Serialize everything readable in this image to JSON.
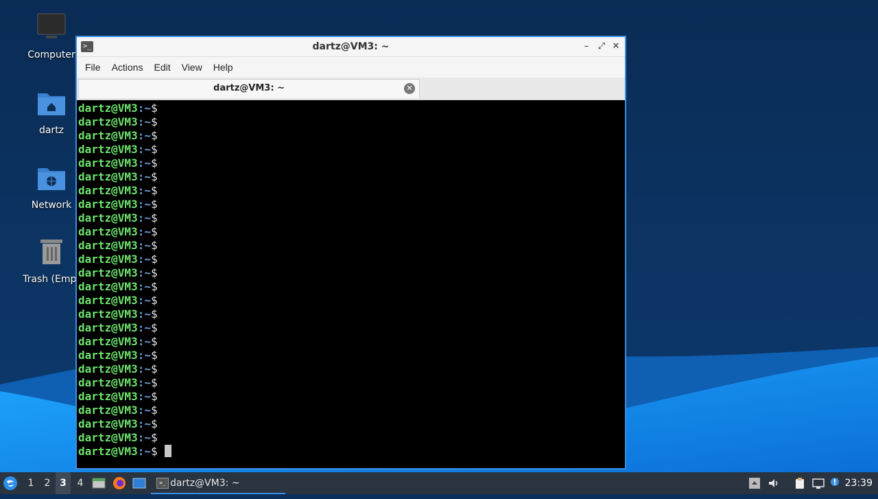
{
  "desktop": {
    "icons": [
      {
        "label": "Computer",
        "icon": "computer-icon"
      },
      {
        "label": "dartz",
        "icon": "home-folder-icon"
      },
      {
        "label": "Network",
        "icon": "network-folder-icon"
      },
      {
        "label": "Trash (Empt",
        "icon": "trash-icon"
      }
    ]
  },
  "window": {
    "title": "dartz@VM3: ~",
    "controls": {
      "minimize": "–",
      "maximize": "⤢",
      "close": "✕"
    },
    "menu": [
      "File",
      "Actions",
      "Edit",
      "View",
      "Help"
    ],
    "tab_label": "dartz@VM3: ~",
    "tab_close": "✕"
  },
  "terminal": {
    "prompt_user": "dartz@VM3",
    "prompt_path": ":~",
    "prompt_symbol": "$",
    "line_count": 26
  },
  "taskbar": {
    "workspaces": [
      "1",
      "2",
      "3",
      "4"
    ],
    "active_workspace": "3",
    "launchers": [
      "file-manager-icon",
      "firefox-icon",
      "desktop-icon"
    ],
    "task_label": "dartz@VM3: ~",
    "tray_icons": [
      "up-arrow-icon",
      "volume-icon",
      "clipboard-icon",
      "network-icon",
      "notification-icon"
    ],
    "clock": "23:39"
  },
  "colors": {
    "prompt_user": "#6ee26e",
    "prompt_path": "#6fa0d8",
    "accent": "#3d8ee0"
  }
}
